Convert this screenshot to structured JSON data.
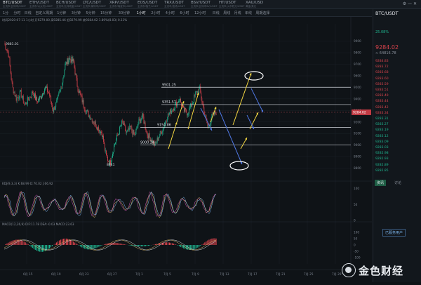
{
  "tabs": [
    {
      "label": "BTC/USDT",
      "sub": "主流币/比特币/USDT"
    },
    {
      "label": "ETH/USDT",
      "sub": "主流币/以太坊/USDT"
    },
    {
      "label": "BCH/USDT",
      "sub": "主流币/比特现金/USDT"
    },
    {
      "label": "LTC/USDT",
      "sub": "主流币/莱特币/USDT"
    },
    {
      "label": "XRP/USDT",
      "sub": "主流币/瑞波币/USDT"
    },
    {
      "label": "EOS/USDT",
      "sub": "主流币/柚子/USDT"
    },
    {
      "label": "TRX/USDT",
      "sub": "主流币/波场/USDT"
    },
    {
      "label": "BSV/USDT",
      "sub": "主流币/比特币SV/USDT"
    },
    {
      "label": "HT/USDT",
      "sub": "主流币/火币积分/USDT"
    },
    {
      "label": "XAU/USD",
      "sub": "黄金/美元"
    }
  ],
  "toolbar": [
    "1分",
    "分时",
    "日线",
    "自定义周期",
    "1分钟",
    "3分钟",
    "5分钟",
    "15分钟",
    "30分钟",
    "1小时",
    "2小时",
    "4小时",
    "6小时",
    "12小时",
    "日线",
    "周线",
    "月线",
    "年线",
    "周期选择"
  ],
  "toolbar_active": "1小时",
  "info_line": "时间2020-07-11 1小时  开9279.00  高9285.46  低9279.99  收9284.02  1.89%(8.03)  0.11%",
  "kdj_label": "KDJ(9,3,3)  K:68.99  D:70.02  J:66.92",
  "macd_label": "MACD(12,26,9)  DIF:11.78  DEA:-0.03  MACD:23.63",
  "price_labels": [
    {
      "text": "9501.25",
      "price": 9501
    },
    {
      "text": "9351.57",
      "price": 9351
    },
    {
      "text": "9154.86",
      "price": 9154
    },
    {
      "text": "9000.24",
      "price": 9000
    }
  ],
  "extreme_labels": [
    {
      "text": "9881.01"
    },
    {
      "text": "8841"
    }
  ],
  "current_price": "9284.02",
  "chart_data": {
    "type": "line",
    "title": "",
    "xlabel": "",
    "ylabel": "",
    "x_ticks": [
      "6月 15",
      "6月 19",
      "6月 23",
      "6月 27",
      "7月 1",
      "7月 5",
      "7月 9",
      "7月 13",
      "7月 17",
      "7月 21",
      "7月 25",
      "7月 29"
    ],
    "ylim": [
      8700,
      10050
    ],
    "y_ticks": [
      9900,
      9800,
      9700,
      9600,
      9500,
      9400,
      9300,
      9200,
      9100,
      9000,
      8900,
      8800
    ],
    "series": [
      {
        "name": "",
        "values": [
          9881,
          9800,
          9500,
          9400,
          9450,
          9350,
          9400,
          9460,
          9380,
          9420,
          9500,
          9450,
          9300,
          9380,
          9500,
          9700,
          9750,
          9720,
          9500,
          9400,
          9300,
          9250,
          9200,
          9150,
          9100,
          8900,
          8841,
          9000,
          9100,
          9200,
          9100,
          9150,
          9080,
          9200,
          9250,
          9100,
          9050,
          9000,
          9080,
          9150,
          9250,
          9300,
          9350,
          9400,
          9300,
          9280,
          9350,
          9450,
          9480,
          9300,
          9150,
          9250,
          9284
        ]
      }
    ],
    "kdj_ylim": [
      0,
      110
    ],
    "kdj_ticks": [
      100,
      50,
      0
    ],
    "macd_ylim": [
      -150,
      150
    ],
    "macd_ticks": [
      100,
      50,
      0,
      -50,
      -100
    ]
  },
  "right_panel": {
    "title": "BTC/USDT",
    "pct": "25.08%",
    "price_main": "9284.02",
    "price_sub": "≈ 64816.78",
    "orderbook": [
      "9284.83",
      "9283.72",
      "9283.68",
      "9283.60",
      "9283.59",
      "9283.51",
      "9283.49",
      "9283.44",
      "9283.42",
      "9283.34",
      "9283.31",
      "9283.27",
      "9283.19",
      "9283.12",
      "9283.09",
      "9283.03",
      "9282.98",
      "9282.93",
      "9282.89",
      "9282.85"
    ],
    "tab_a": "资讯",
    "tab_b": "讨论",
    "button_label": "已服务用户"
  },
  "watermark": "金色财经",
  "colors": {
    "bg": "#0f1317",
    "up": "#1fb58f",
    "down": "#d9434c",
    "yellow": "#f5d842",
    "blue": "#4f76e0",
    "k": "#e6c06b",
    "d": "#cf56b7",
    "j": "#7db7f0"
  }
}
